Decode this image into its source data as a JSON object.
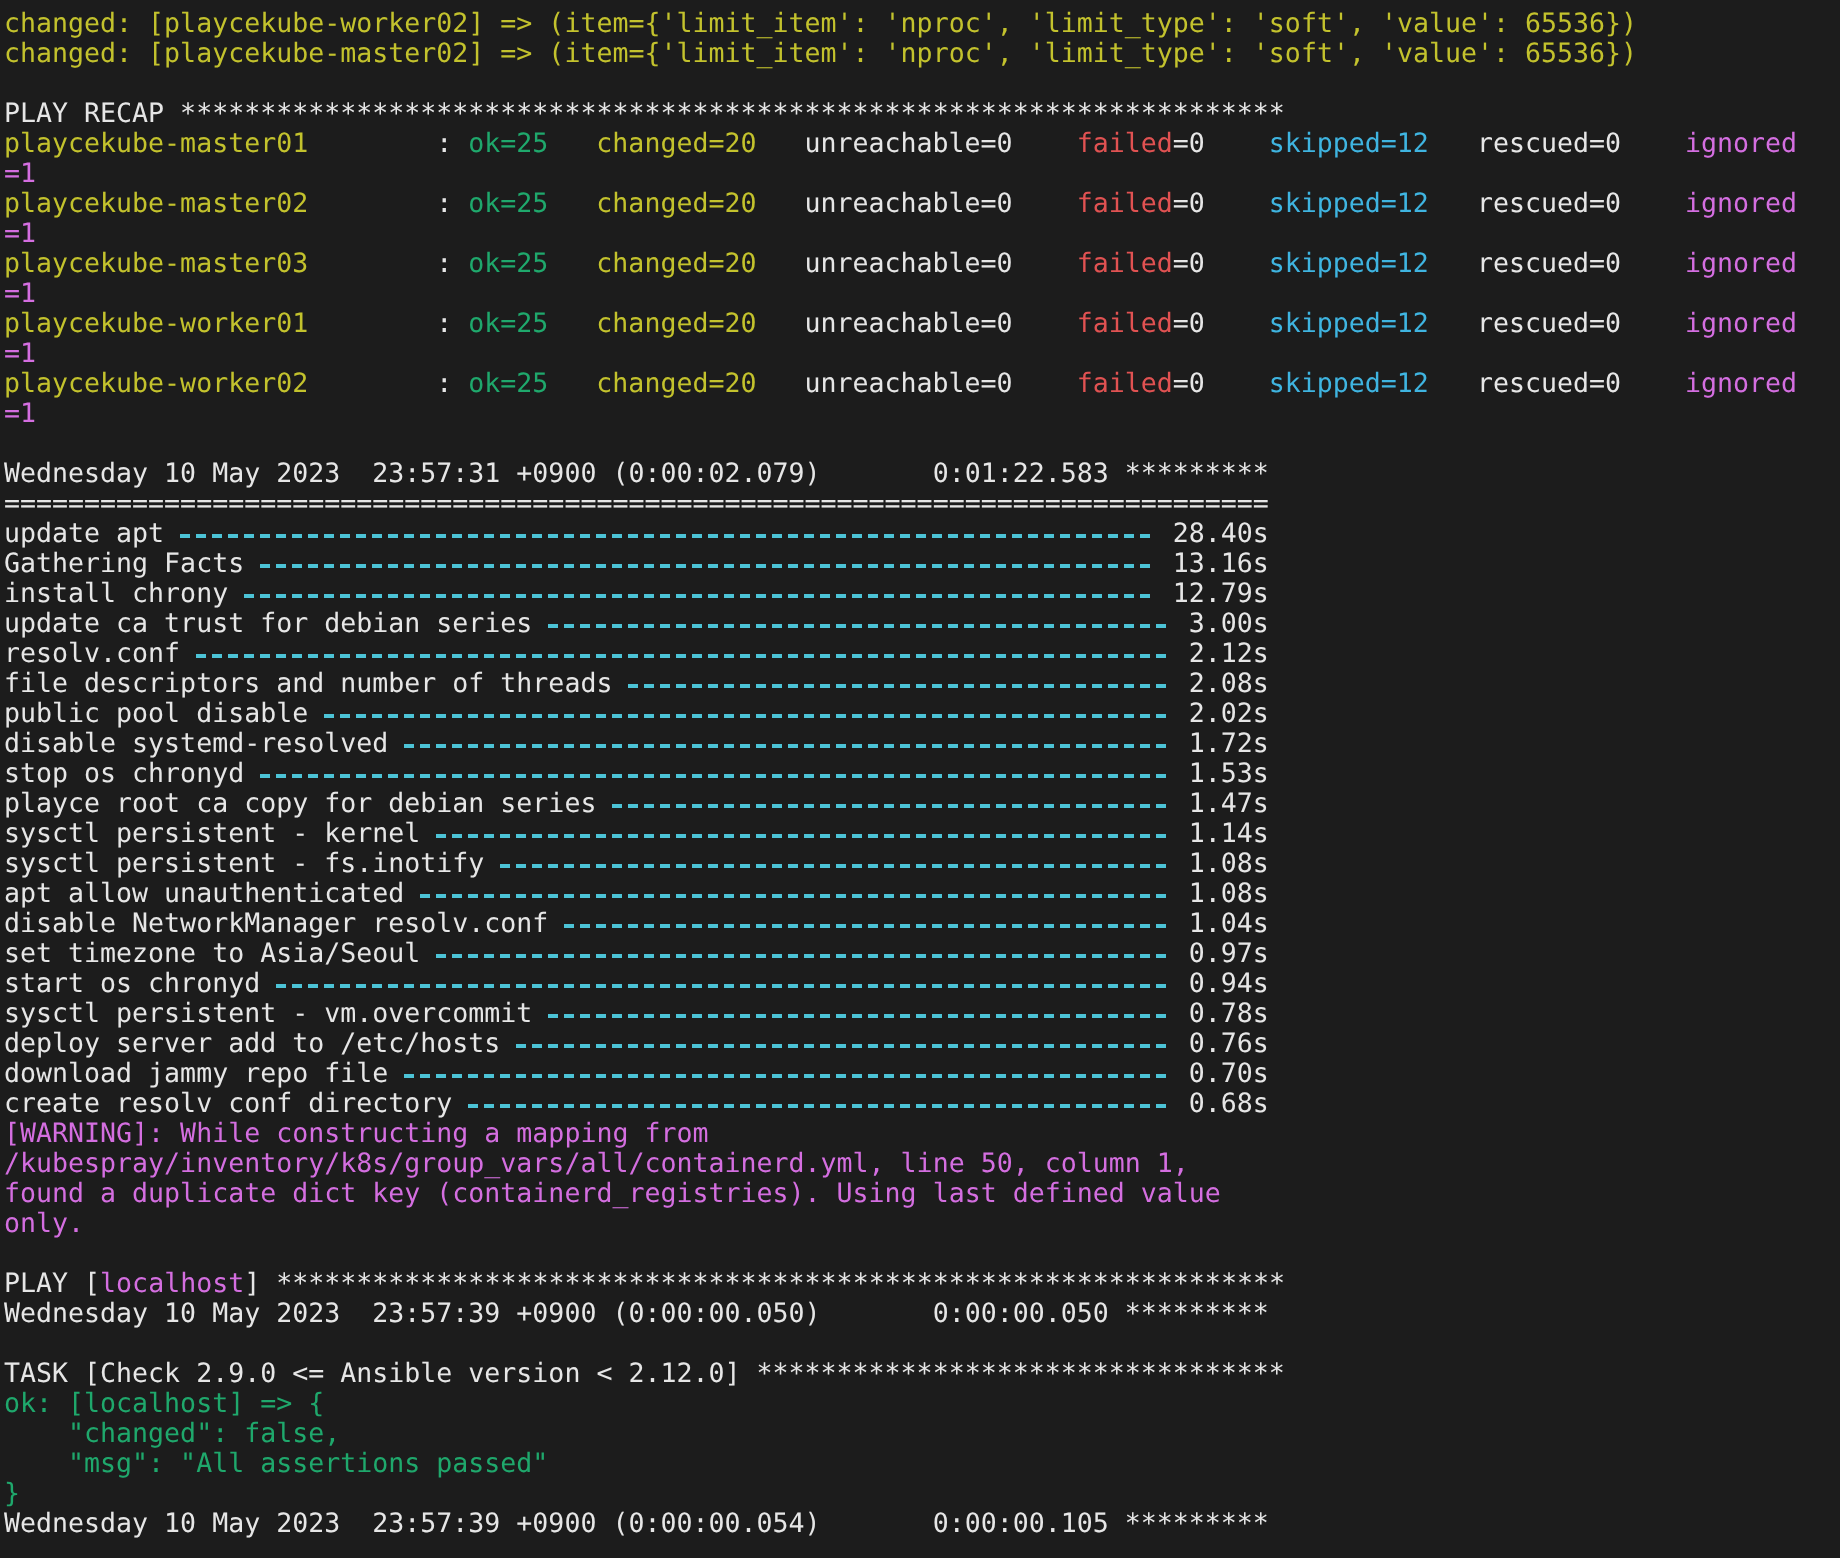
{
  "changed_lines": [
    {
      "text": "changed: [playcekube-worker02] => (item={'limit_item': 'nproc', 'limit_type': 'soft', 'value': 65536})"
    },
    {
      "text": "changed: [playcekube-master02] => (item={'limit_item': 'nproc', 'limit_type': 'soft', 'value': 65536})"
    }
  ],
  "play_recap": {
    "header": "PLAY RECAP *********************************************************************",
    "hosts": [
      {
        "host": "playcekube-master01",
        "separator": ":",
        "stats": [
          {
            "label": "ok",
            "value": "=25",
            "color": "#1fa86c",
            "value_colored": true,
            "wrapped": false
          },
          {
            "label": "changed",
            "value": "=20",
            "color": "#c3c22d",
            "value_colored": true,
            "wrapped": false
          },
          {
            "label": "unreachable",
            "value": "=0",
            "color": "#e6e6e6",
            "wrapped": false
          },
          {
            "label": "failed",
            "value": "=0",
            "color": "#e05252",
            "value_colored": false,
            "wrapped": false
          },
          {
            "label": "skipped",
            "value": "=12",
            "color": "#3fb4e0",
            "value_colored": true,
            "wrapped": false
          },
          {
            "label": "rescued",
            "value": "=0",
            "color": "#e6e6e6",
            "wrapped": false
          },
          {
            "label": "ignored",
            "value": "=1",
            "color": "#d46ee0",
            "value_colored": true,
            "wrapped": true
          }
        ]
      },
      {
        "host": "playcekube-master02",
        "separator": ":",
        "stats": [
          {
            "label": "ok",
            "value": "=25",
            "color": "#1fa86c",
            "value_colored": true,
            "wrapped": false
          },
          {
            "label": "changed",
            "value": "=20",
            "color": "#c3c22d",
            "value_colored": true,
            "wrapped": false
          },
          {
            "label": "unreachable",
            "value": "=0",
            "color": "#e6e6e6",
            "wrapped": false
          },
          {
            "label": "failed",
            "value": "=0",
            "color": "#e05252",
            "value_colored": false,
            "wrapped": false
          },
          {
            "label": "skipped",
            "value": "=12",
            "color": "#3fb4e0",
            "value_colored": true,
            "wrapped": false
          },
          {
            "label": "rescued",
            "value": "=0",
            "color": "#e6e6e6",
            "wrapped": false
          },
          {
            "label": "ignored",
            "value": "=1",
            "color": "#d46ee0",
            "value_colored": true,
            "wrapped": true
          }
        ]
      },
      {
        "host": "playcekube-master03",
        "separator": ":",
        "stats": [
          {
            "label": "ok",
            "value": "=25",
            "color": "#1fa86c",
            "value_colored": true,
            "wrapped": false
          },
          {
            "label": "changed",
            "value": "=20",
            "color": "#c3c22d",
            "value_colored": true,
            "wrapped": false
          },
          {
            "label": "unreachable",
            "value": "=0",
            "color": "#e6e6e6",
            "wrapped": false
          },
          {
            "label": "failed",
            "value": "=0",
            "color": "#e05252",
            "value_colored": false,
            "wrapped": false
          },
          {
            "label": "skipped",
            "value": "=12",
            "color": "#3fb4e0",
            "value_colored": true,
            "wrapped": false
          },
          {
            "label": "rescued",
            "value": "=0",
            "color": "#e6e6e6",
            "wrapped": false
          },
          {
            "label": "ignored",
            "value": "=1",
            "color": "#d46ee0",
            "value_colored": true,
            "wrapped": true
          }
        ]
      },
      {
        "host": "playcekube-worker01",
        "separator": ":",
        "stats": [
          {
            "label": "ok",
            "value": "=25",
            "color": "#1fa86c",
            "value_colored": true,
            "wrapped": false
          },
          {
            "label": "changed",
            "value": "=20",
            "color": "#c3c22d",
            "value_colored": true,
            "wrapped": false
          },
          {
            "label": "unreachable",
            "value": "=0",
            "color": "#e6e6e6",
            "wrapped": false
          },
          {
            "label": "failed",
            "value": "=0",
            "color": "#e05252",
            "value_colored": false,
            "wrapped": false
          },
          {
            "label": "skipped",
            "value": "=12",
            "color": "#3fb4e0",
            "value_colored": true,
            "wrapped": false
          },
          {
            "label": "rescued",
            "value": "=0",
            "color": "#e6e6e6",
            "wrapped": false
          },
          {
            "label": "ignored",
            "value": "=1",
            "color": "#d46ee0",
            "value_colored": true,
            "wrapped": true
          }
        ]
      },
      {
        "host": "playcekube-worker02",
        "separator": ":",
        "stats": [
          {
            "label": "ok",
            "value": "=25",
            "color": "#1fa86c",
            "value_colored": true,
            "wrapped": false
          },
          {
            "label": "changed",
            "value": "=20",
            "color": "#c3c22d",
            "value_colored": true,
            "wrapped": false
          },
          {
            "label": "unreachable",
            "value": "=0",
            "color": "#e6e6e6",
            "wrapped": false
          },
          {
            "label": "failed",
            "value": "=0",
            "color": "#e05252",
            "value_colored": false,
            "wrapped": false
          },
          {
            "label": "skipped",
            "value": "=12",
            "color": "#3fb4e0",
            "value_colored": true,
            "wrapped": false
          },
          {
            "label": "rescued",
            "value": "=0",
            "color": "#e6e6e6",
            "wrapped": false
          },
          {
            "label": "ignored",
            "value": "=1",
            "color": "#d46ee0",
            "value_colored": true,
            "wrapped": true
          }
        ]
      }
    ]
  },
  "profile": {
    "timestamp": "Wednesday 10 May 2023  23:57:31 +0900 (0:00:02.079)       0:01:22.583 *********",
    "rule": "===============================================================================",
    "tasks": [
      {
        "name": "update apt",
        "duration": "28.40s"
      },
      {
        "name": "Gathering Facts",
        "duration": "13.16s"
      },
      {
        "name": "install chrony",
        "duration": "12.79s"
      },
      {
        "name": "update ca trust for debian series",
        "duration": "3.00s"
      },
      {
        "name": "resolv.conf",
        "duration": "2.12s"
      },
      {
        "name": "file descriptors and number of threads",
        "duration": "2.08s"
      },
      {
        "name": "public pool disable",
        "duration": "2.02s"
      },
      {
        "name": "disable systemd-resolved",
        "duration": "1.72s"
      },
      {
        "name": "stop os chronyd",
        "duration": "1.53s"
      },
      {
        "name": "playce root ca copy for debian series",
        "duration": "1.47s"
      },
      {
        "name": "sysctl persistent - kernel",
        "duration": "1.14s"
      },
      {
        "name": "sysctl persistent - fs.inotify",
        "duration": "1.08s"
      },
      {
        "name": "apt allow unauthenticated",
        "duration": "1.08s"
      },
      {
        "name": "disable NetworkManager resolv.conf",
        "duration": "1.04s"
      },
      {
        "name": "set timezone to Asia/Seoul",
        "duration": "0.97s"
      },
      {
        "name": "start os chronyd",
        "duration": "0.94s"
      },
      {
        "name": "sysctl persistent - vm.overcommit",
        "duration": "0.78s"
      },
      {
        "name": "deploy server add to /etc/hosts",
        "duration": "0.76s"
      },
      {
        "name": "download jammy repo file",
        "duration": "0.70s"
      },
      {
        "name": "create resolv conf directory",
        "duration": "0.68s"
      }
    ]
  },
  "warning": "[WARNING]: While constructing a mapping from /kubespray/inventory/k8s/group_vars/all/containerd.yml, line 50, column 1, found a duplicate dict key (containerd_registries). Using last defined value only.",
  "play": {
    "prefix": "PLAY [",
    "host": "localhost",
    "suffix": "] ***************************************************************",
    "timestamp": "Wednesday 10 May 2023  23:57:39 +0900 (0:00:00.050)       0:00:00.050 *********"
  },
  "task": {
    "header": "TASK [Check 2.9.0 <= Ansible version < 2.12.0] *********************************",
    "result_lines": [
      "ok: [localhost] => {",
      "    \"changed\": false,",
      "    \"msg\": \"All assertions passed\"",
      "}"
    ],
    "timestamp": "Wednesday 10 May 2023  23:57:39 +0900 (0:00:00.054)       0:00:00.105 *********"
  }
}
